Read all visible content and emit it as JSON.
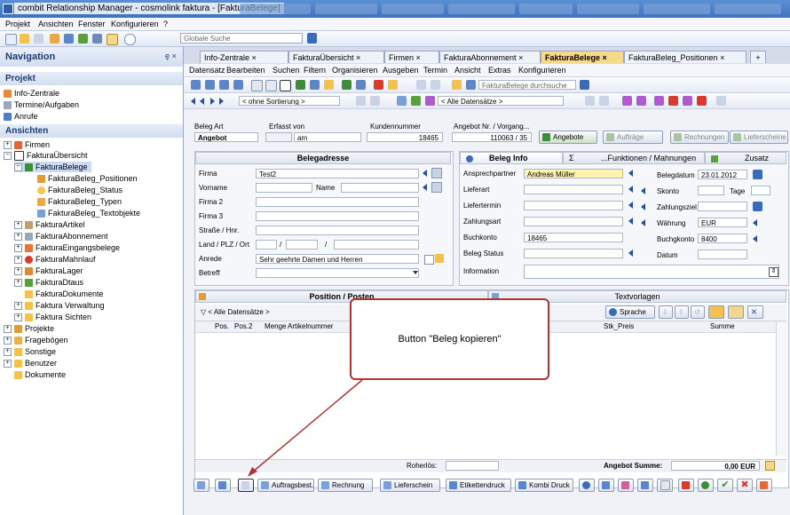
{
  "window": {
    "title": "combit Relationship Manager - cosmolink faktura - [FakturaBelege]"
  },
  "menubar": {
    "items": [
      "Projekt",
      "Ansichten",
      "Fenster",
      "Konfigurieren",
      "?"
    ]
  },
  "global_search": {
    "placeholder": "Globale Suche"
  },
  "navigation": {
    "title": "Navigation",
    "pin": "ȩ ×",
    "projekt_header": "Projekt",
    "projekt_items": [
      "Info-Zentrale",
      "Termine/Aufgaben",
      "Anrufe"
    ],
    "ansichten_header": "Ansichten",
    "tree": [
      {
        "label": "Firmen",
        "level": 0
      },
      {
        "label": "FakturaÜbersicht",
        "level": 0
      },
      {
        "label": "FakturaBelege",
        "level": 1
      },
      {
        "label": "FakturaBeleg_Positionen",
        "level": 2
      },
      {
        "label": "FakturaBeleg_Status",
        "level": 2
      },
      {
        "label": "FakturaBeleg_Typen",
        "level": 2
      },
      {
        "label": "FakturaBeleg_Textobjekte",
        "level": 2
      },
      {
        "label": "FakturaArtikel",
        "level": 1
      },
      {
        "label": "FakturaAbonnement",
        "level": 1
      },
      {
        "label": "FakturaEingangsbelege",
        "level": 1
      },
      {
        "label": "FakturaMahnlauf",
        "level": 1
      },
      {
        "label": "FakturaLager",
        "level": 1
      },
      {
        "label": "FakturaDtaus",
        "level": 1
      },
      {
        "label": "FakturaDokumente",
        "level": 1
      },
      {
        "label": "Faktura Verwaltung",
        "level": 1
      },
      {
        "label": "Faktura Sichten",
        "level": 1
      },
      {
        "label": "Projekte",
        "level": 0
      },
      {
        "label": "Fragebögen",
        "level": 0
      },
      {
        "label": "Sonstige",
        "level": 0
      },
      {
        "label": "Benutzer",
        "level": 0
      },
      {
        "label": "Dokumente",
        "level": 0
      }
    ]
  },
  "doc_tabs": [
    "Info-Zentrale",
    "FakturaÜbersicht",
    "Firmen",
    "FakturaAbonnement",
    "FakturaBelege",
    "FakturaBeleg_Positionen"
  ],
  "doc_tab_close": "×",
  "doc_tab_add": "+",
  "content_menu": [
    "Datensatz",
    "Bearbeiten",
    "Suchen",
    "Filtern",
    "Organisieren",
    "Ausgeben",
    "Termin",
    "Ansicht",
    "Extras",
    "Konfigurieren"
  ],
  "toolbar": {
    "search_placeholder": "FakturaBelege durchsuche",
    "sort": "< ohne Sortierung >",
    "filter": "< Alle Datensätze >"
  },
  "header_fields": {
    "beleg_art_label": "Beleg Art",
    "beleg_art_value": "Angebot",
    "erfasst_von_label": "Erfasst von",
    "erfasst_von_value": "am",
    "kundennummer_label": "Kundennummer",
    "kundennummer_value": "18465",
    "angebot_nr_label": "Angebot Nr. / Vorgang...",
    "angebot_nr_value": "110063 / 35"
  },
  "status_buttons": [
    "Angebote",
    "Aufträge",
    "Rechnungen",
    "Lieferscheine"
  ],
  "belegadresse": {
    "title": "Belegadresse",
    "firma_label": "Firma",
    "firma_value": "Test2",
    "vorname_label": "Vorname",
    "name_label": "Name",
    "firma2_label": "Firma 2",
    "firma3_label": "Firma 3",
    "strasse_label": "Straße / Hnr.",
    "land_label": "Land / PLZ / Ort",
    "slash1": "/",
    "slash2": "/",
    "anrede_label": "Anrede",
    "anrede_value": "Sehr geehrte Damen und Herren",
    "betreff_label": "Betreff"
  },
  "beleg_info_tabs": [
    "Beleg Info",
    "...Funktionen / Mahnungen",
    "Zusatz"
  ],
  "beleg_info": {
    "ansprechpartner_label": "Ansprechpartner",
    "ansprechpartner_value": "Andreas Müller",
    "lieferart_label": "Lieferart",
    "liefertermin_label": "Liefertermin",
    "zahlungsart_label": "Zahlungsart",
    "buchkonto_label": "Buchkonto",
    "buchkonto_value": "18465",
    "beleg_status_label": "Beleg Status",
    "information_label": "Information",
    "belegdatum_label": "Belegdatum",
    "belegdatum_value": "23.01.2012",
    "skonto_label": "Skonto",
    "tage_label": "Tage",
    "zahlungsziel_label": "Zahlungsziel",
    "waehrung_label": "Währung",
    "waehrung_value": "EUR",
    "buchgkonto_label": "Buchgkonto",
    "buchgkonto_value": "8400",
    "datum_label": "Datum"
  },
  "positions": {
    "title": "Position / Posten",
    "textvorlagen_title": "Textvorlagen",
    "filter": "< Alle Datensätze >",
    "sprache_button": "Sprache",
    "columns": [
      "Pos.",
      "Pos.2",
      "Menge",
      "Artikelnummer",
      "Stk_Preis",
      "Summe"
    ],
    "roherloes_label": "Roherlös:",
    "summe_label": "Angebot Summe:",
    "summe_value": "0,00 EUR"
  },
  "callout": {
    "text": "Button \"Beleg kopieren\""
  },
  "bottom_buttons": [
    "Auftragsbest.",
    "Rechnung",
    "Lieferschein",
    "Etikettendruck",
    "Kombi Druck"
  ],
  "colors": {
    "accent": "#2a4f9a",
    "callout_border": "#b23232",
    "active_tab": "#f7d98a",
    "highlight": "#fff3b0"
  }
}
